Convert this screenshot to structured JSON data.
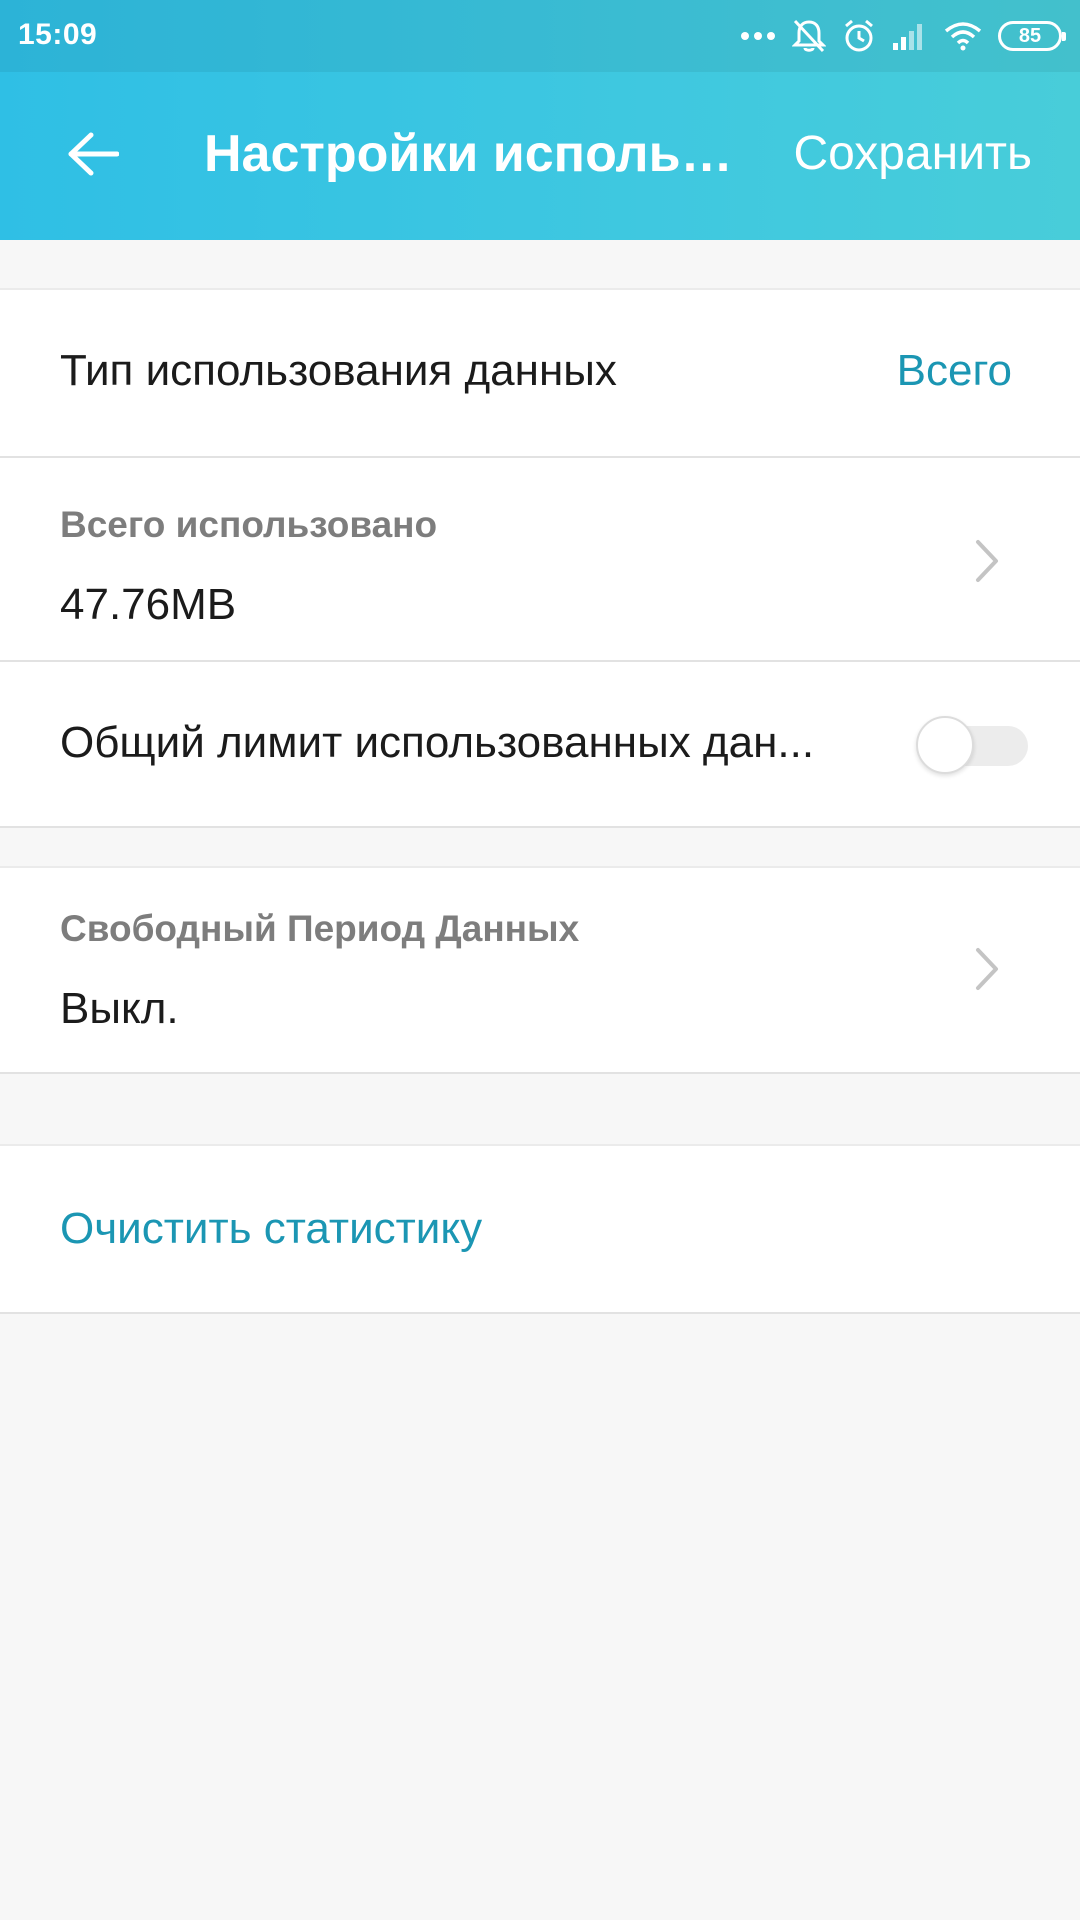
{
  "status_bar": {
    "time": "15:09",
    "battery": "85",
    "icons": [
      "more-dots-icon",
      "bell-muted-icon",
      "alarm-icon",
      "signal-icon",
      "wifi-icon",
      "battery-icon"
    ]
  },
  "app_bar": {
    "title": "Настройки использ...",
    "save_label": "Сохранить",
    "back_icon": "arrow-left-icon"
  },
  "settings": {
    "data_usage_type": {
      "label": "Тип использования данных",
      "value": "Всего"
    },
    "total_used": {
      "caption": "Всего использовано",
      "value": "47.76MB"
    },
    "total_limit": {
      "label": "Общий лимит использованных дан...",
      "enabled": false
    },
    "free_period": {
      "caption": "Свободный Период Данных",
      "value": "Выкл."
    },
    "clear_stats": {
      "label": "Очистить статистику"
    }
  },
  "colors": {
    "header_gradient_start": "#2fbfe5",
    "header_gradient_end": "#48cdd9",
    "accent": "#1b96b3",
    "background": "#f7f7f7"
  }
}
